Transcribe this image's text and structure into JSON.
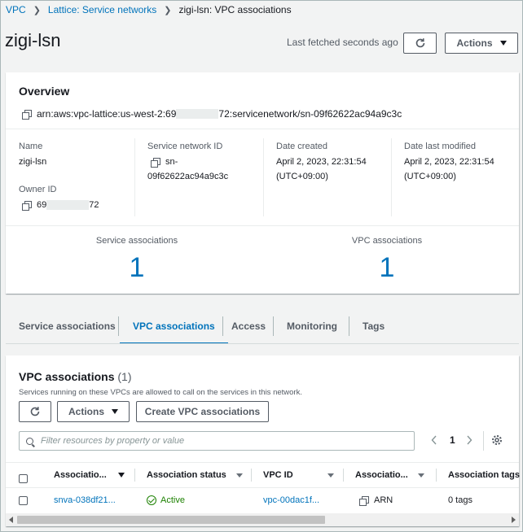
{
  "breadcrumb": {
    "items": [
      "VPC",
      "Lattice: Service networks"
    ],
    "current": "zigi-lsn: VPC associations"
  },
  "header": {
    "title": "zigi-lsn",
    "fetched": "Last fetched seconds ago",
    "actions_label": "Actions"
  },
  "overview": {
    "title": "Overview",
    "arn_prefix": "arn:aws:vpc-lattice:us-west-2:69",
    "arn_suffix": "72:servicenetwork/sn-09f62622ac94a9c3c",
    "name_label": "Name",
    "name_value": "zigi-lsn",
    "owner_label": "Owner ID",
    "owner_prefix": "69",
    "owner_suffix": "72",
    "snid_label": "Service network ID",
    "snid_line1": "sn-",
    "snid_line2": "09f62622ac94a9c3c",
    "created_label": "Date created",
    "created_line1": "April 2, 2023, 22:31:54",
    "created_line2": "(UTC+09:00)",
    "modified_label": "Date last modified",
    "modified_line1": "April 2, 2023, 22:31:54",
    "modified_line2": "(UTC+09:00)",
    "service_assoc_label": "Service associations",
    "service_assoc_count": "1",
    "vpc_assoc_label": "VPC associations",
    "vpc_assoc_count": "1"
  },
  "tabs": [
    "Service associations",
    "VPC associations",
    "Access",
    "Monitoring",
    "Tags"
  ],
  "active_tab": "VPC associations",
  "vpc_section": {
    "title": "VPC associations",
    "count": "(1)",
    "description": "Services running on these VPCs are allowed to call on the services in this network.",
    "actions_label": "Actions",
    "create_label": "Create VPC associations",
    "search_placeholder": "Filter resources by property or value",
    "page": "1",
    "columns": [
      "Associatio...",
      "Association status",
      "VPC ID",
      "Associatio...",
      "Association tags"
    ],
    "rows": [
      {
        "id": "snva-038df21...",
        "status": "Active",
        "vpc": "vpc-00dac1f...",
        "type": "ARN",
        "tags": "0 tags"
      }
    ]
  },
  "colors": {
    "link": "#0073bb",
    "success": "#1d8102",
    "background": "#f2f3f3"
  },
  "icons": [
    "chevron-right-icon",
    "refresh-icon",
    "caret-down-icon",
    "copy-icon",
    "search-icon",
    "chevron-left-icon",
    "settings-gear-icon",
    "status-success-icon",
    "sort-caret-icon"
  ]
}
